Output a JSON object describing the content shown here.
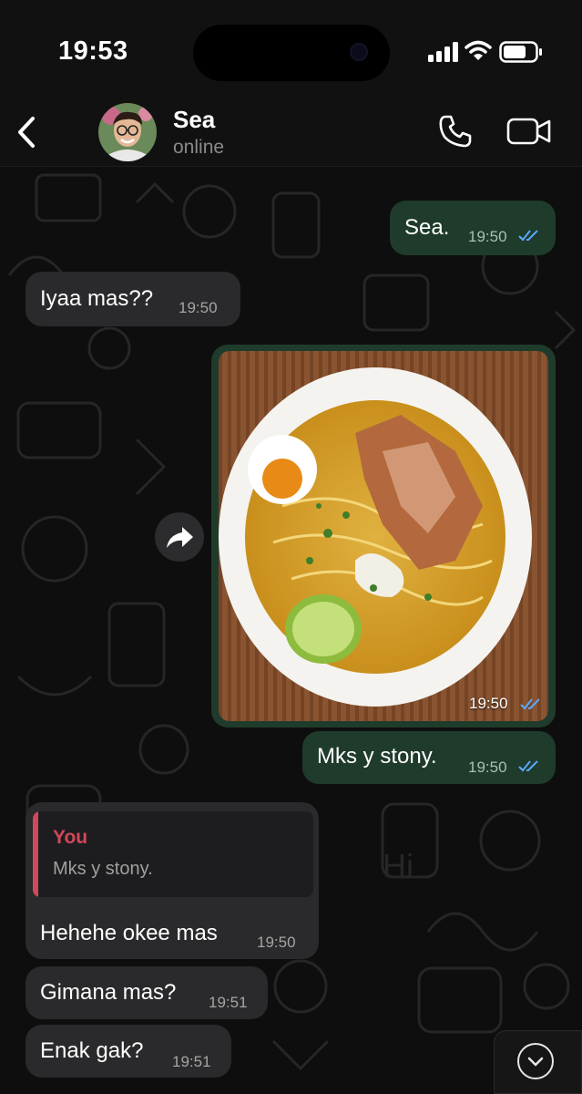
{
  "status_bar": {
    "time": "19:53"
  },
  "chat_header": {
    "contact_name": "Sea",
    "contact_status": "online"
  },
  "messages": [
    {
      "direction": "outgoing",
      "text": "Sea.",
      "time": "19:50",
      "read": true
    },
    {
      "direction": "incoming",
      "text": "Iyaa mas??",
      "time": "19:50"
    },
    {
      "direction": "outgoing",
      "type": "image",
      "image_description": "bowl of chicken noodle soup",
      "time": "19:50",
      "read": true
    },
    {
      "direction": "outgoing",
      "text": "Mks y stony.",
      "time": "19:50",
      "read": true
    },
    {
      "direction": "incoming",
      "reply_to": {
        "author": "You",
        "text": "Mks y stony."
      },
      "text": "Hehehe okee mas",
      "time": "19:50"
    },
    {
      "direction": "incoming",
      "text": "Gimana mas?",
      "time": "19:51"
    },
    {
      "direction": "incoming",
      "text": "Enak gak?",
      "time": "19:51"
    }
  ],
  "colors": {
    "outgoing_bubble": "#1f3b2b",
    "incoming_bubble": "#2a2a2c",
    "read_ticks": "#5aa9ff",
    "quote_accent": "#d1485a"
  },
  "icons": [
    "back-icon",
    "call-icon",
    "video-call-icon",
    "forward-icon",
    "chevron-down-icon",
    "read-ticks-icon"
  ]
}
